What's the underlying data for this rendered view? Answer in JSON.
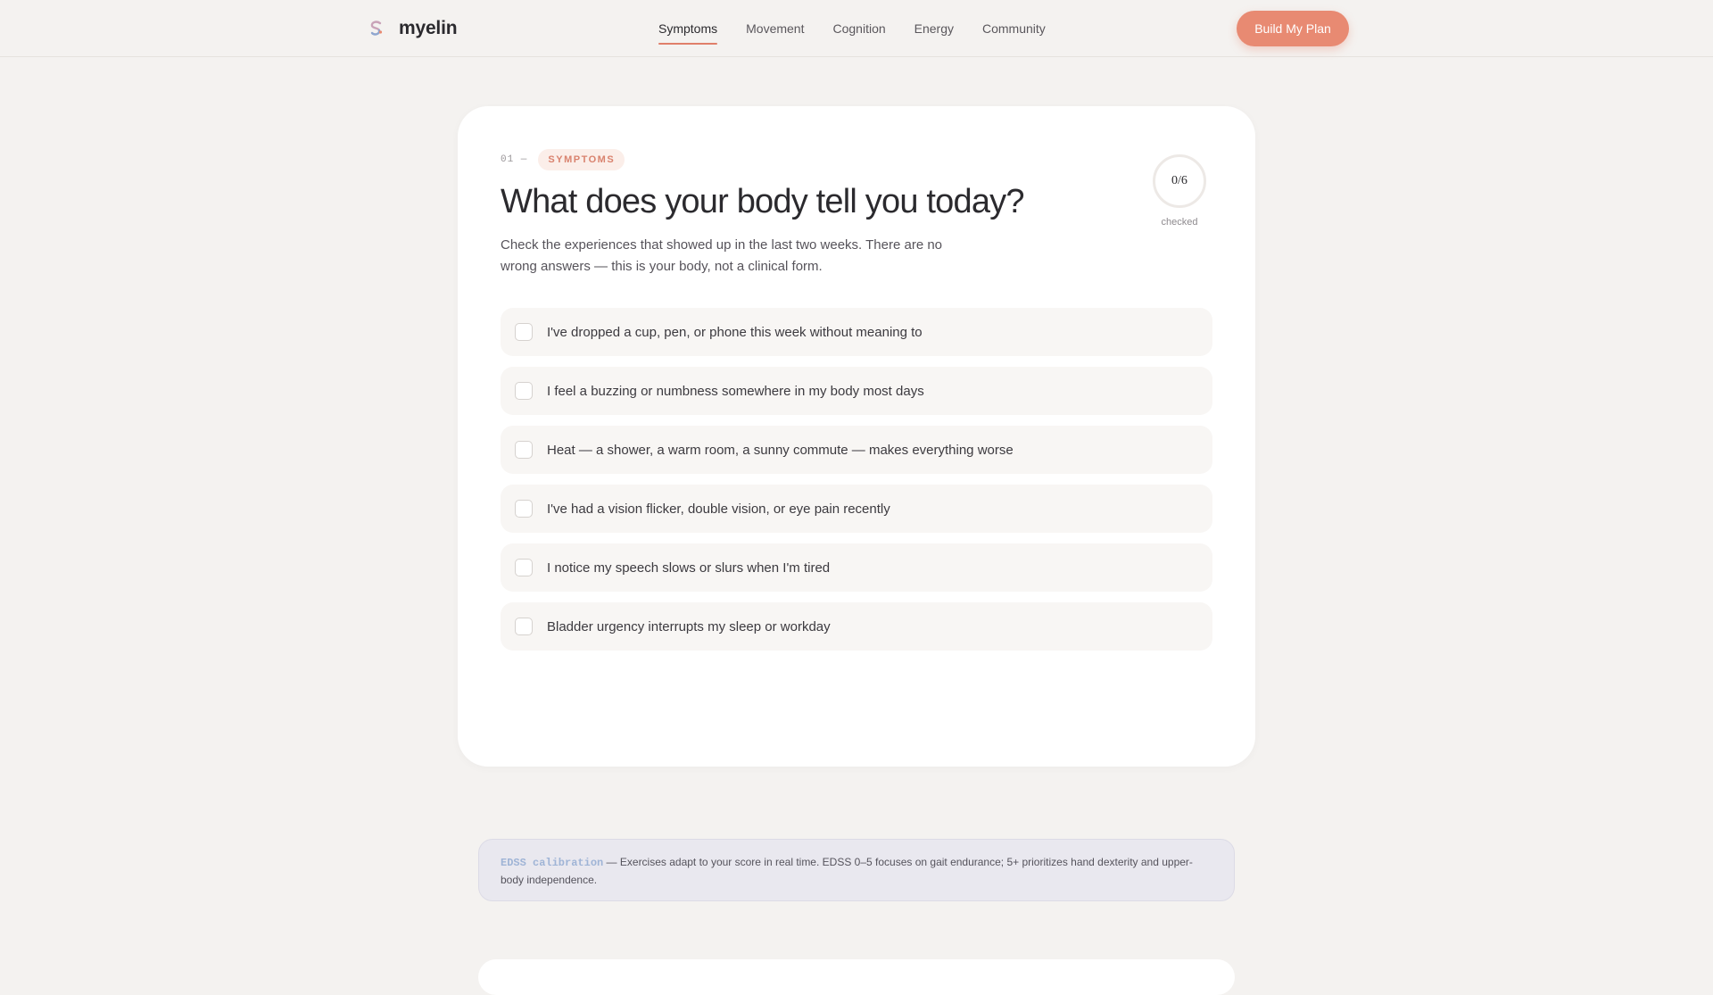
{
  "brand": {
    "name": "myelin"
  },
  "nav": {
    "items": [
      {
        "label": "Symptoms",
        "active": true
      },
      {
        "label": "Movement",
        "active": false
      },
      {
        "label": "Cognition",
        "active": false
      },
      {
        "label": "Energy",
        "active": false
      },
      {
        "label": "Community",
        "active": false
      }
    ]
  },
  "header": {
    "cta_label": "Build My Plan"
  },
  "card": {
    "step_number": "01 —",
    "step_tag": "SYMPTOMS",
    "title": "What does your body tell you today?",
    "intro": "Check the experiences that showed up in the last two weeks. There are no wrong answers — this is your body, not a clinical form.",
    "progress": {
      "value": "0/6",
      "label": "checked",
      "checked": 0,
      "total": 6
    },
    "options": [
      {
        "label": "I've dropped a cup, pen, or phone this week without meaning to",
        "checked": false
      },
      {
        "label": "I feel a buzzing or numbness somewhere in my body most days",
        "checked": false
      },
      {
        "label": "Heat — a shower, a warm room, a sunny commute — makes everything worse",
        "checked": false
      },
      {
        "label": "I've had a vision flicker, double vision, or eye pain recently",
        "checked": false
      },
      {
        "label": "I notice my speech slows or slurs when I'm tired",
        "checked": false
      },
      {
        "label": "Bladder urgency interrupts my sleep or workday",
        "checked": false
      }
    ]
  },
  "note": {
    "key": "EDSS calibration",
    "text": " — Exercises adapt to your score in real time. EDSS 0–5 focuses on gait endurance; 5+ prioritizes hand dexterity and upper-body independence."
  },
  "colors": {
    "accent": "#e88a72",
    "background": "#f4f2f0",
    "card": "#ffffff",
    "note_background": "#e9e8ef",
    "note_key": "#9fb4d6"
  },
  "icons": {
    "brand": "myelin-logo-icon"
  }
}
